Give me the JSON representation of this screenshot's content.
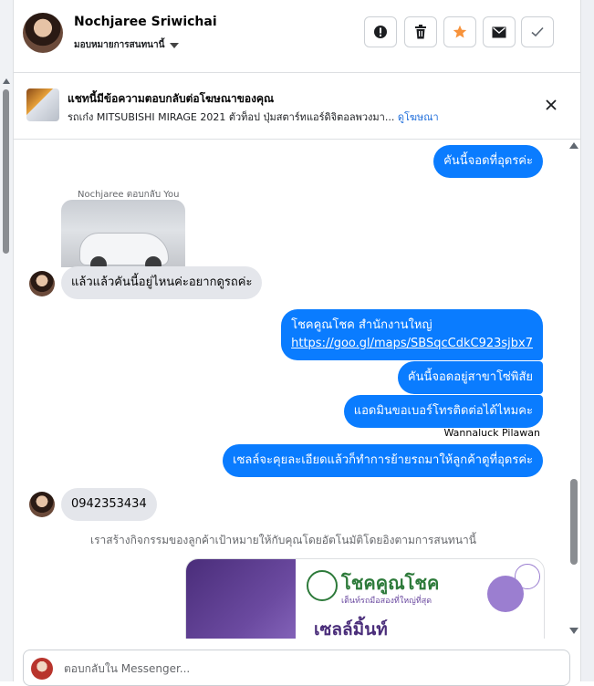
{
  "header": {
    "contact_name": "Nochjaree Sriwichai",
    "assign_label": "มอบหมายการสนทนานี้",
    "actions": [
      {
        "name": "report-button",
        "icon": "exclamation-icon"
      },
      {
        "name": "delete-button",
        "icon": "trash-icon"
      },
      {
        "name": "star-button",
        "icon": "star-icon"
      },
      {
        "name": "mark-unread-button",
        "icon": "envelope-icon"
      },
      {
        "name": "mark-done-button",
        "icon": "check-icon"
      }
    ]
  },
  "ad_banner": {
    "title": "แชทนี้มีข้อความตอบกลับต่อโฆษณาของคุณ",
    "subtitle": "รถเก๋ง MITSUBISHI MIRAGE 2021 ตัวท็อป ปุ่มสตาร์ทแอร์ดิจิตอลพวงมา...",
    "link": "ดูโฆษณา"
  },
  "messages": {
    "m1": "คันนี้จอดที่อุดรค่ะ",
    "reply_label": "Nochjaree ตอบกลับ You",
    "m2": "แล้วแล้วคันนี้อยู่ไหนค่ะอยากดูรถค่ะ",
    "m3_line1": "โชคคูณโชค สำนักงานใหญ่",
    "m3_link": "https://goo.gl/maps/SBSqcCdkC923sjbx7",
    "m4": "คันนี้จอดอยู่สาขาโซ่พิสัย",
    "m5": "แอดมินขอเบอร์โทรติดต่อได้ไหมคะ",
    "sender_name": "Wannaluck Pilawan",
    "m6": "เซลล์จะคุยละเอียดแล้วก็ทำการย้ายรถมาให้ลูกค้าดูที่อุดรค่ะ",
    "m7": "0942353434",
    "notice": "เราสร้างกิจกรรมของลูกค้าเป้าหมายให้กับคุณโดยอัตโนมัติโดยอิงตามการสนทนานี้"
  },
  "promo_card": {
    "brand": "โชคคูณโชค",
    "tagline": "เต็นท์รถมือสองที่ใหญ่ที่สุด",
    "headline": "เซลล์มิ้นท์"
  },
  "composer": {
    "placeholder": "ตอบกลับใน Messenger..."
  },
  "colors": {
    "outgoing_bubble": "#0a7cff",
    "incoming_bubble": "#e4e6eb",
    "link": "#216fdb",
    "star": "#f7923a"
  }
}
